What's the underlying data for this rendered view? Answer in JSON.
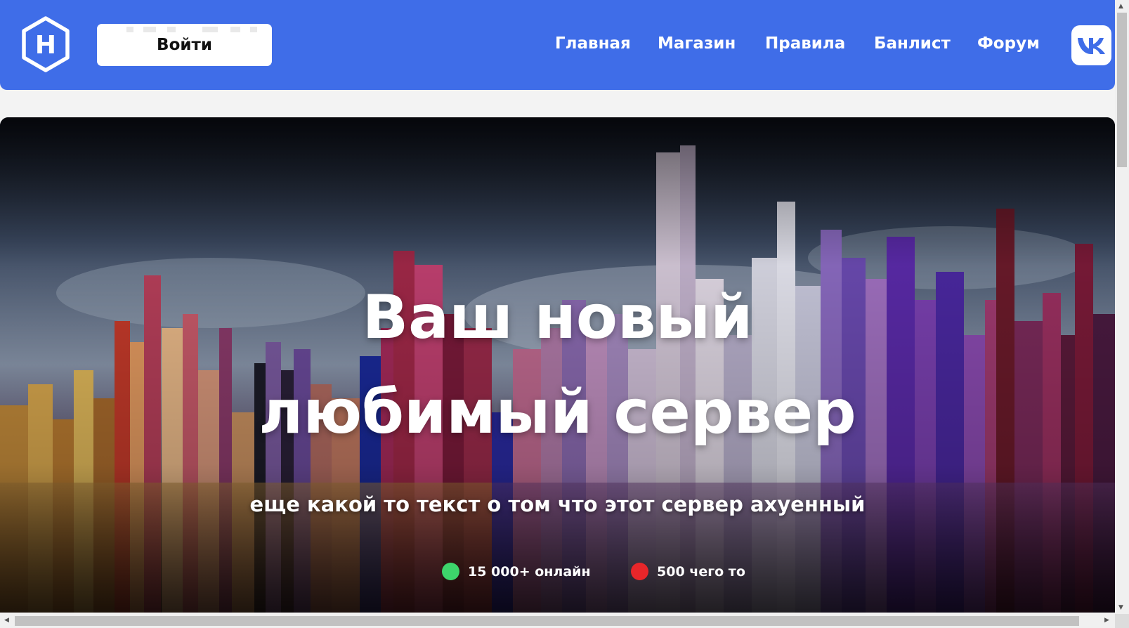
{
  "header": {
    "logo_letter": "H",
    "login_label": "Войти",
    "nav": [
      {
        "label": "Главная"
      },
      {
        "label": "Магазин"
      },
      {
        "label": "Правила"
      },
      {
        "label": "Банлист"
      },
      {
        "label": "Форум"
      }
    ],
    "social_icon": "vk-icon"
  },
  "hero": {
    "title_line1": "Ваш новый",
    "title_line2": "любимый сервер",
    "subtitle": "еще какой то текст о том что этот сервер ахуенный",
    "stats": [
      {
        "text": "15 000+ онлайн",
        "status_color": "#3dd46b"
      },
      {
        "text": "500 чего то",
        "status_color": "#e8262a"
      }
    ]
  },
  "colors": {
    "nav_bg": "#3f6de8",
    "page_bg": "#f3f3f3"
  }
}
